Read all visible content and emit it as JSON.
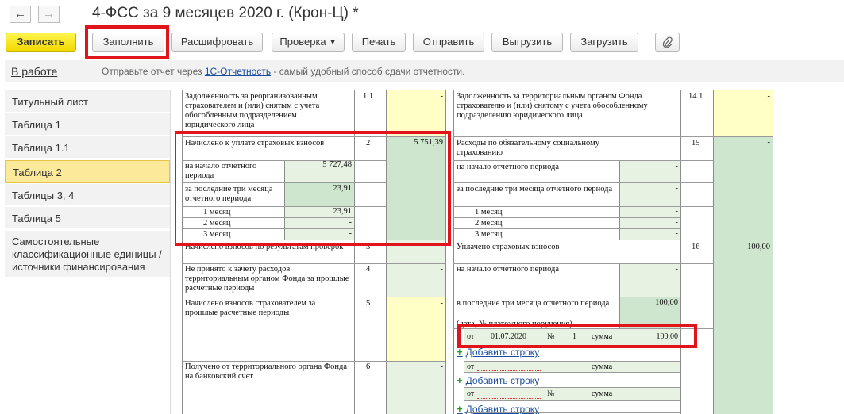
{
  "header": {
    "back": "←",
    "forward": "→",
    "title": "4-ФСС за 9 месяцев 2020 г. (Крон-Ц) *"
  },
  "toolbar": {
    "save": "Записать",
    "fill": "Заполнить",
    "decode": "Расшифровать",
    "check": "Проверка",
    "print": "Печать",
    "send": "Отправить",
    "export": "Выгрузить",
    "import": "Загрузить",
    "attach_icon": "paperclip-icon"
  },
  "infobar": {
    "status": "В работе",
    "text_before": "Отправьте отчет через ",
    "link": "1С-Отчетность",
    "text_after": " - самый удобный способ сдачи отчетности."
  },
  "sidebar": {
    "items": [
      {
        "label": "Титульный лист"
      },
      {
        "label": "Таблица 1"
      },
      {
        "label": "Таблица 1.1"
      },
      {
        "label": "Таблица 2"
      },
      {
        "label": "Таблицы 3, 4"
      },
      {
        "label": "Таблица 5"
      },
      {
        "label": "Самостоятельные классификационные единицы / источники финансирования"
      }
    ],
    "selected": "Таблица 2"
  },
  "form": {
    "left": {
      "r11": {
        "label": "Задолженность за реорганизованным страхователем и (или) снятым с учета обособленным подразделением юридического лица",
        "code": "1.1",
        "value": "-"
      },
      "r2": {
        "label": "Начислено к уплате страховых взносов",
        "code": "2",
        "value": "5 751,39"
      },
      "r2_start": {
        "label": "на начало отчетного периода",
        "value": "5 727,48"
      },
      "r2_last3": {
        "label": "за последние три месяца отчетного периода",
        "value": "23,91"
      },
      "r2_m1": {
        "label": "1 месяц",
        "value": "23,91"
      },
      "r2_m2": {
        "label": "2 месяц",
        "value": "-"
      },
      "r2_m3": {
        "label": "3 месяц",
        "value": "-"
      },
      "r3": {
        "label": "Начислено взносов по результатам проверок",
        "code": "3",
        "value": "-"
      },
      "r4": {
        "label": "Не принято к зачету расходов территориальным органом Фонда за прошлые расчетные периоды",
        "code": "4",
        "value": "-"
      },
      "r5": {
        "label": "Начислено взносов страхователем за прошлые расчетные периоды",
        "code": "5",
        "value": "-"
      },
      "r6": {
        "label": "Получено от территориального органа Фонда на банковский счет",
        "code": "6",
        "value": "-"
      }
    },
    "right": {
      "r141": {
        "label": "Задолженность за территориальным органом Фонда страхователю и (или) снятому с учета обособленному подразделению юридического лица",
        "code": "14.1",
        "value": "-"
      },
      "r15": {
        "label": "Расходы по обязательному социальному страхованию",
        "code": "15",
        "value": "-"
      },
      "r15_start": {
        "label": "на начало отчетного периода",
        "value": "-"
      },
      "r15_last3": {
        "label": "за последние три месяца отчетного периода",
        "value": "-"
      },
      "r15_m1": {
        "label": "1 месяц",
        "value": "-"
      },
      "r15_m2": {
        "label": "2 месяц",
        "value": "-"
      },
      "r15_m3": {
        "label": "3 месяц",
        "value": "-"
      },
      "r16": {
        "label": "Уплачено страховых взносов",
        "code": "16",
        "value": "100,00"
      },
      "r16_start": {
        "label": "на начало отчетного периода",
        "value": "-"
      },
      "r16_last3": {
        "label": "в последние три месяца отчетного периода",
        "note": "(дата, № платежного поручения)",
        "value": "100,00"
      },
      "payment": {
        "from_label": "от",
        "date": "01.07.2020",
        "no_label": "№",
        "no": "1",
        "sum_label": "сумма",
        "sum": "100,00"
      },
      "add_row": "Добавить строку",
      "empty_from": "от",
      "empty_no": "№",
      "empty_sum": "сумма"
    }
  }
}
